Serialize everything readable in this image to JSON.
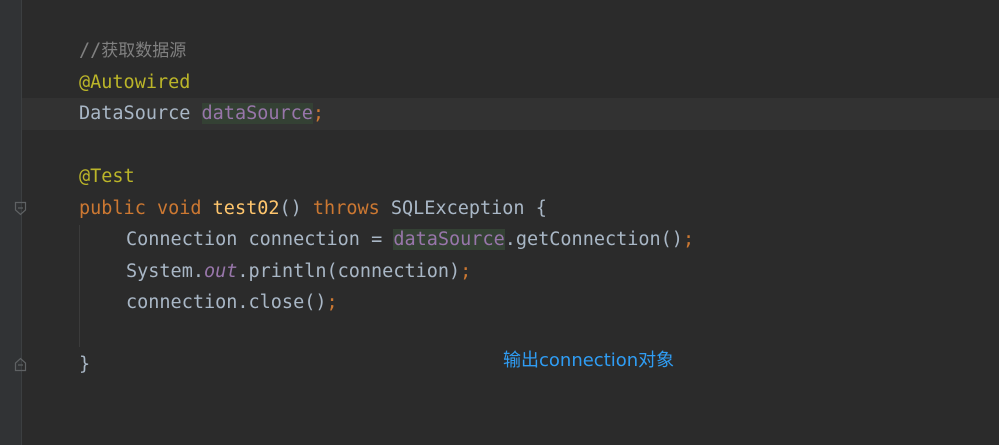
{
  "editor": {
    "lines": {
      "comment": {
        "slashes": "//",
        "text": "获取数据源"
      },
      "autowired": {
        "annotation": "@Autowired"
      },
      "field_decl": {
        "type": "DataSource",
        "name": "dataSource",
        "semicolon": ";"
      },
      "test_annotation": {
        "annotation": "@Test"
      },
      "method_sig": {
        "kw_public": "public",
        "kw_void": "void",
        "method_name": "test02",
        "parens": "()",
        "kw_throws": "throws",
        "exception": "SQLException",
        "brace_open": "{"
      },
      "conn_line": {
        "type": "Connection",
        "var": "connection",
        "assign": "=",
        "target": "dataSource",
        "call": ".getConnection()",
        "semicolon": ";"
      },
      "println_line": {
        "class": "System.",
        "field": "out",
        "call": ".println(connection)",
        "semicolon": ";"
      },
      "close_line": {
        "call": "connection.close()",
        "semicolon": ";"
      },
      "closing_brace": {
        "brace": "}"
      }
    },
    "annotation_note": "输出connection对象",
    "colors": {
      "background": "#2b2b2b",
      "keyword": "#cc7832",
      "annotation": "#bbb529",
      "method": "#ffc66d",
      "field": "#9876aa",
      "comment": "#808080",
      "text": "#a9b7c6",
      "note": "#2f9df4"
    }
  }
}
